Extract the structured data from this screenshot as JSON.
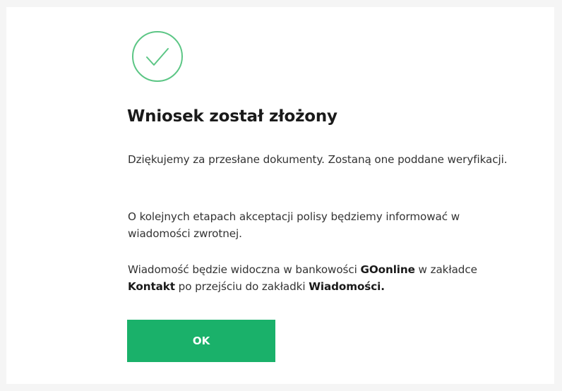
{
  "icons": {
    "success": "check-circle-icon"
  },
  "colors": {
    "success_green": "#1ab16a",
    "icon_green": "#5cc685"
  },
  "dialog": {
    "title": "Wniosek został złożony",
    "paragraph1": "Dziękujemy za przesłane dokumenty. Zostaną one poddane weryfikacji.",
    "paragraph2": "O kolejnych etapach akceptacji polisy będziemy informować w wiadomości zwrotnej.",
    "paragraph3": {
      "part1": "Wiadomość będzie widoczna w bankowości ",
      "bold1": "GOonline",
      "part2": " w zakładce ",
      "bold2": "Kontakt",
      "part3": " po przejściu do zakładki ",
      "bold3": "Wiadomości."
    },
    "ok_label": "OK"
  }
}
